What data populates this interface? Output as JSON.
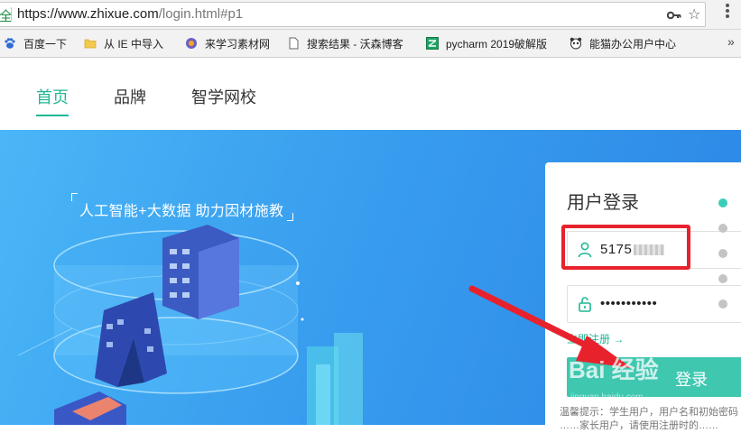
{
  "browser": {
    "secure_label": "全",
    "url_main": "https://www.zhixue.com",
    "url_path": "/login.html#p1",
    "bookmarks": [
      {
        "label": "百度一下",
        "icon": "baidu-paw-icon"
      },
      {
        "label": "从 IE 中导入",
        "icon": "folder-icon"
      },
      {
        "label": "来学习素材网",
        "icon": "site-icon"
      },
      {
        "label": "搜索结果 - 沃森博客",
        "icon": "page-icon"
      },
      {
        "label": "pycharm 2019破解版",
        "icon": "pycharm-icon"
      },
      {
        "label": "能猫办公用户中心",
        "icon": "panda-icon"
      }
    ],
    "more_label": "»"
  },
  "site_nav": {
    "items": [
      {
        "label": "首页",
        "active": true
      },
      {
        "label": "品牌",
        "active": false
      },
      {
        "label": "智学网校",
        "active": false
      }
    ]
  },
  "hero": {
    "slogan": "人工智能+大数据 助力因材施教"
  },
  "login": {
    "title": "用户登录",
    "username_value": "5175",
    "password_value": "•••••••••••",
    "register_link": "立即注册 →",
    "submit_label": "登录",
    "hint": "温馨提示：学生用户，用户名和初始密码 ……家长用户，请使用注册时的……"
  },
  "watermark": {
    "text": "Bai 经验",
    "sub": "jingyan.baidu.com"
  },
  "colors": {
    "accent": "#20b795",
    "hero_blue": "#3aa0ef",
    "annotation_red": "#e8222d"
  }
}
